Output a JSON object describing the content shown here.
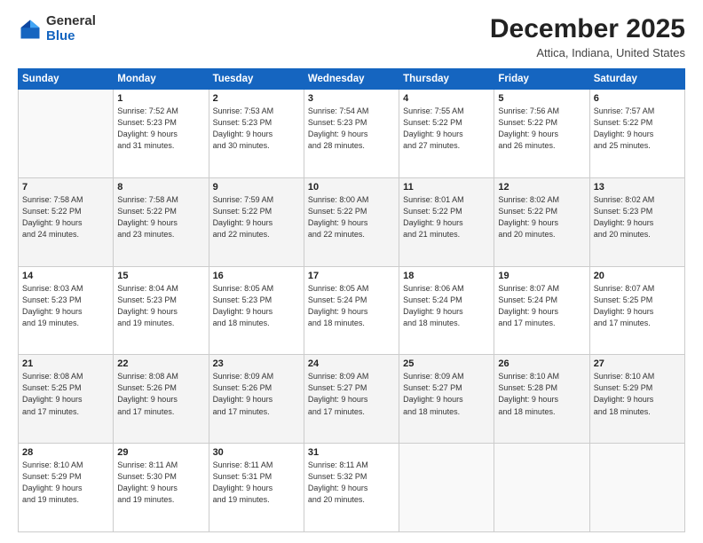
{
  "logo": {
    "general": "General",
    "blue": "Blue"
  },
  "title": "December 2025",
  "subtitle": "Attica, Indiana, United States",
  "days_header": [
    "Sunday",
    "Monday",
    "Tuesday",
    "Wednesday",
    "Thursday",
    "Friday",
    "Saturday"
  ],
  "weeks": [
    [
      {
        "num": "",
        "info": ""
      },
      {
        "num": "1",
        "info": "Sunrise: 7:52 AM\nSunset: 5:23 PM\nDaylight: 9 hours\nand 31 minutes."
      },
      {
        "num": "2",
        "info": "Sunrise: 7:53 AM\nSunset: 5:23 PM\nDaylight: 9 hours\nand 30 minutes."
      },
      {
        "num": "3",
        "info": "Sunrise: 7:54 AM\nSunset: 5:23 PM\nDaylight: 9 hours\nand 28 minutes."
      },
      {
        "num": "4",
        "info": "Sunrise: 7:55 AM\nSunset: 5:22 PM\nDaylight: 9 hours\nand 27 minutes."
      },
      {
        "num": "5",
        "info": "Sunrise: 7:56 AM\nSunset: 5:22 PM\nDaylight: 9 hours\nand 26 minutes."
      },
      {
        "num": "6",
        "info": "Sunrise: 7:57 AM\nSunset: 5:22 PM\nDaylight: 9 hours\nand 25 minutes."
      }
    ],
    [
      {
        "num": "7",
        "info": "Sunrise: 7:58 AM\nSunset: 5:22 PM\nDaylight: 9 hours\nand 24 minutes."
      },
      {
        "num": "8",
        "info": "Sunrise: 7:58 AM\nSunset: 5:22 PM\nDaylight: 9 hours\nand 23 minutes."
      },
      {
        "num": "9",
        "info": "Sunrise: 7:59 AM\nSunset: 5:22 PM\nDaylight: 9 hours\nand 22 minutes."
      },
      {
        "num": "10",
        "info": "Sunrise: 8:00 AM\nSunset: 5:22 PM\nDaylight: 9 hours\nand 22 minutes."
      },
      {
        "num": "11",
        "info": "Sunrise: 8:01 AM\nSunset: 5:22 PM\nDaylight: 9 hours\nand 21 minutes."
      },
      {
        "num": "12",
        "info": "Sunrise: 8:02 AM\nSunset: 5:22 PM\nDaylight: 9 hours\nand 20 minutes."
      },
      {
        "num": "13",
        "info": "Sunrise: 8:02 AM\nSunset: 5:23 PM\nDaylight: 9 hours\nand 20 minutes."
      }
    ],
    [
      {
        "num": "14",
        "info": "Sunrise: 8:03 AM\nSunset: 5:23 PM\nDaylight: 9 hours\nand 19 minutes."
      },
      {
        "num": "15",
        "info": "Sunrise: 8:04 AM\nSunset: 5:23 PM\nDaylight: 9 hours\nand 19 minutes."
      },
      {
        "num": "16",
        "info": "Sunrise: 8:05 AM\nSunset: 5:23 PM\nDaylight: 9 hours\nand 18 minutes."
      },
      {
        "num": "17",
        "info": "Sunrise: 8:05 AM\nSunset: 5:24 PM\nDaylight: 9 hours\nand 18 minutes."
      },
      {
        "num": "18",
        "info": "Sunrise: 8:06 AM\nSunset: 5:24 PM\nDaylight: 9 hours\nand 18 minutes."
      },
      {
        "num": "19",
        "info": "Sunrise: 8:07 AM\nSunset: 5:24 PM\nDaylight: 9 hours\nand 17 minutes."
      },
      {
        "num": "20",
        "info": "Sunrise: 8:07 AM\nSunset: 5:25 PM\nDaylight: 9 hours\nand 17 minutes."
      }
    ],
    [
      {
        "num": "21",
        "info": "Sunrise: 8:08 AM\nSunset: 5:25 PM\nDaylight: 9 hours\nand 17 minutes."
      },
      {
        "num": "22",
        "info": "Sunrise: 8:08 AM\nSunset: 5:26 PM\nDaylight: 9 hours\nand 17 minutes."
      },
      {
        "num": "23",
        "info": "Sunrise: 8:09 AM\nSunset: 5:26 PM\nDaylight: 9 hours\nand 17 minutes."
      },
      {
        "num": "24",
        "info": "Sunrise: 8:09 AM\nSunset: 5:27 PM\nDaylight: 9 hours\nand 17 minutes."
      },
      {
        "num": "25",
        "info": "Sunrise: 8:09 AM\nSunset: 5:27 PM\nDaylight: 9 hours\nand 18 minutes."
      },
      {
        "num": "26",
        "info": "Sunrise: 8:10 AM\nSunset: 5:28 PM\nDaylight: 9 hours\nand 18 minutes."
      },
      {
        "num": "27",
        "info": "Sunrise: 8:10 AM\nSunset: 5:29 PM\nDaylight: 9 hours\nand 18 minutes."
      }
    ],
    [
      {
        "num": "28",
        "info": "Sunrise: 8:10 AM\nSunset: 5:29 PM\nDaylight: 9 hours\nand 19 minutes."
      },
      {
        "num": "29",
        "info": "Sunrise: 8:11 AM\nSunset: 5:30 PM\nDaylight: 9 hours\nand 19 minutes."
      },
      {
        "num": "30",
        "info": "Sunrise: 8:11 AM\nSunset: 5:31 PM\nDaylight: 9 hours\nand 19 minutes."
      },
      {
        "num": "31",
        "info": "Sunrise: 8:11 AM\nSunset: 5:32 PM\nDaylight: 9 hours\nand 20 minutes."
      },
      {
        "num": "",
        "info": ""
      },
      {
        "num": "",
        "info": ""
      },
      {
        "num": "",
        "info": ""
      }
    ]
  ]
}
